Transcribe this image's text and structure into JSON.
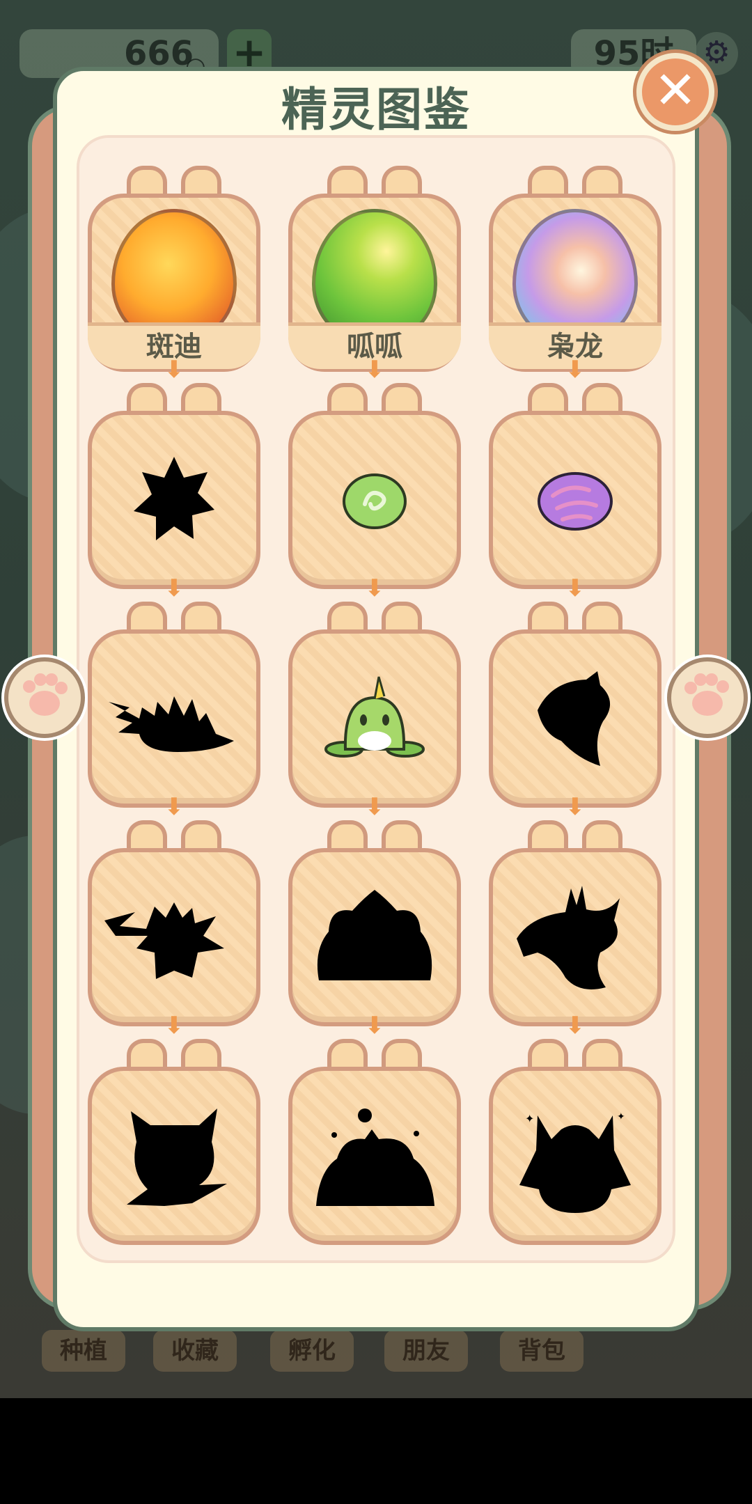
{
  "hud": {
    "coins": "666",
    "time": "95时"
  },
  "bottom_tabs": [
    "种植",
    "收藏",
    "孵化",
    "朋友",
    "背包"
  ],
  "modal": {
    "title": "精灵图鉴"
  },
  "grid": {
    "rows": [
      [
        {
          "type": "egg",
          "name": "斑迪",
          "egg_style": "fire-egg",
          "unlocked": true
        },
        {
          "type": "egg",
          "name": "呱呱",
          "egg_style": "frog-egg",
          "unlocked": true
        },
        {
          "type": "egg",
          "name": "枭龙",
          "egg_style": "rainbow-egg",
          "unlocked": true
        }
      ],
      [
        {
          "type": "silhouette",
          "icon": "spiky-ball-silhouette",
          "unlocked": false
        },
        {
          "type": "creature",
          "icon": "green-seed-creature",
          "unlocked": true
        },
        {
          "type": "creature",
          "icon": "purple-egg-creature",
          "unlocked": true
        }
      ],
      [
        {
          "type": "silhouette",
          "icon": "hedgehog-silhouette",
          "unlocked": false
        },
        {
          "type": "creature",
          "icon": "green-frog-creature",
          "unlocked": true
        },
        {
          "type": "silhouette",
          "icon": "bird-head-silhouette",
          "unlocked": false
        }
      ],
      [
        {
          "type": "silhouette",
          "icon": "lightning-beast-silhouette",
          "unlocked": false
        },
        {
          "type": "silhouette",
          "icon": "big-frog-silhouette",
          "unlocked": false
        },
        {
          "type": "silhouette",
          "icon": "antlered-bird-silhouette",
          "unlocked": false
        }
      ],
      [
        {
          "type": "silhouette",
          "icon": "cat-beast-silhouette",
          "unlocked": false
        },
        {
          "type": "silhouette",
          "icon": "toad-king-silhouette",
          "unlocked": false
        },
        {
          "type": "silhouette",
          "icon": "dragon-king-silhouette",
          "unlocked": false
        }
      ]
    ]
  },
  "colors": {
    "accent": "#eb9868",
    "card_fill": "#fbdcb1",
    "card_border": "#d39c80",
    "title": "#4c6455"
  }
}
